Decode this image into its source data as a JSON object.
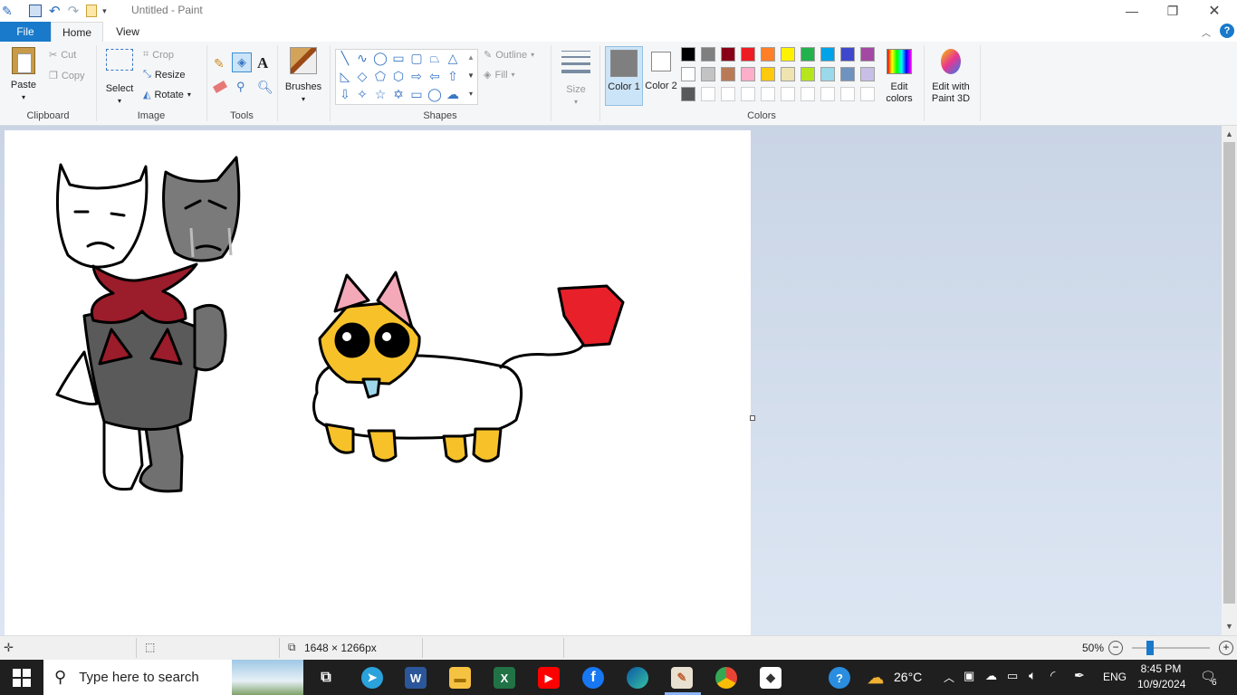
{
  "window": {
    "title": "Untitled - Paint"
  },
  "tabs": {
    "file": "File",
    "home": "Home",
    "view": "View"
  },
  "clipboard": {
    "paste": "Paste",
    "cut": "Cut",
    "copy": "Copy",
    "label": "Clipboard"
  },
  "image": {
    "select": "Select",
    "crop": "Crop",
    "resize": "Resize",
    "rotate": "Rotate",
    "label": "Image"
  },
  "tools": {
    "label": "Tools"
  },
  "brushes": {
    "label": "Brushes"
  },
  "shapes": {
    "outline": "Outline",
    "fill": "Fill",
    "label": "Shapes"
  },
  "size": {
    "label": "Size"
  },
  "colors": {
    "color1": "Color 1",
    "color2": "Color 2",
    "edit": "Edit colors",
    "label": "Colors",
    "color1_value": "#7f7f7f",
    "color2_value": "#ffffff",
    "palette": [
      "#000000",
      "#7f7f7f",
      "#880015",
      "#ed1c24",
      "#ff7f27",
      "#fff200",
      "#22b14c",
      "#00a2e8",
      "#3f48cc",
      "#a349a4",
      "#ffffff",
      "#c3c3c3",
      "#b97a57",
      "#ffaec9",
      "#ffc90e",
      "#efe4b0",
      "#b5e61d",
      "#99d9ea",
      "#7092be",
      "#c8bfe7",
      "#595959",
      "#ffffff",
      "#ffffff",
      "#ffffff",
      "#ffffff",
      "#ffffff",
      "#ffffff",
      "#ffffff",
      "#ffffff",
      "#ffffff"
    ]
  },
  "paint3d": {
    "label": "Edit with Paint 3D"
  },
  "status": {
    "dimensions": "1648 × 1266px",
    "zoom": "50%"
  },
  "taskbar": {
    "search_placeholder": "Type here to search",
    "temperature": "26°C",
    "language": "ENG",
    "time": "8:45 PM",
    "date": "10/9/2024",
    "notifications": "6"
  }
}
